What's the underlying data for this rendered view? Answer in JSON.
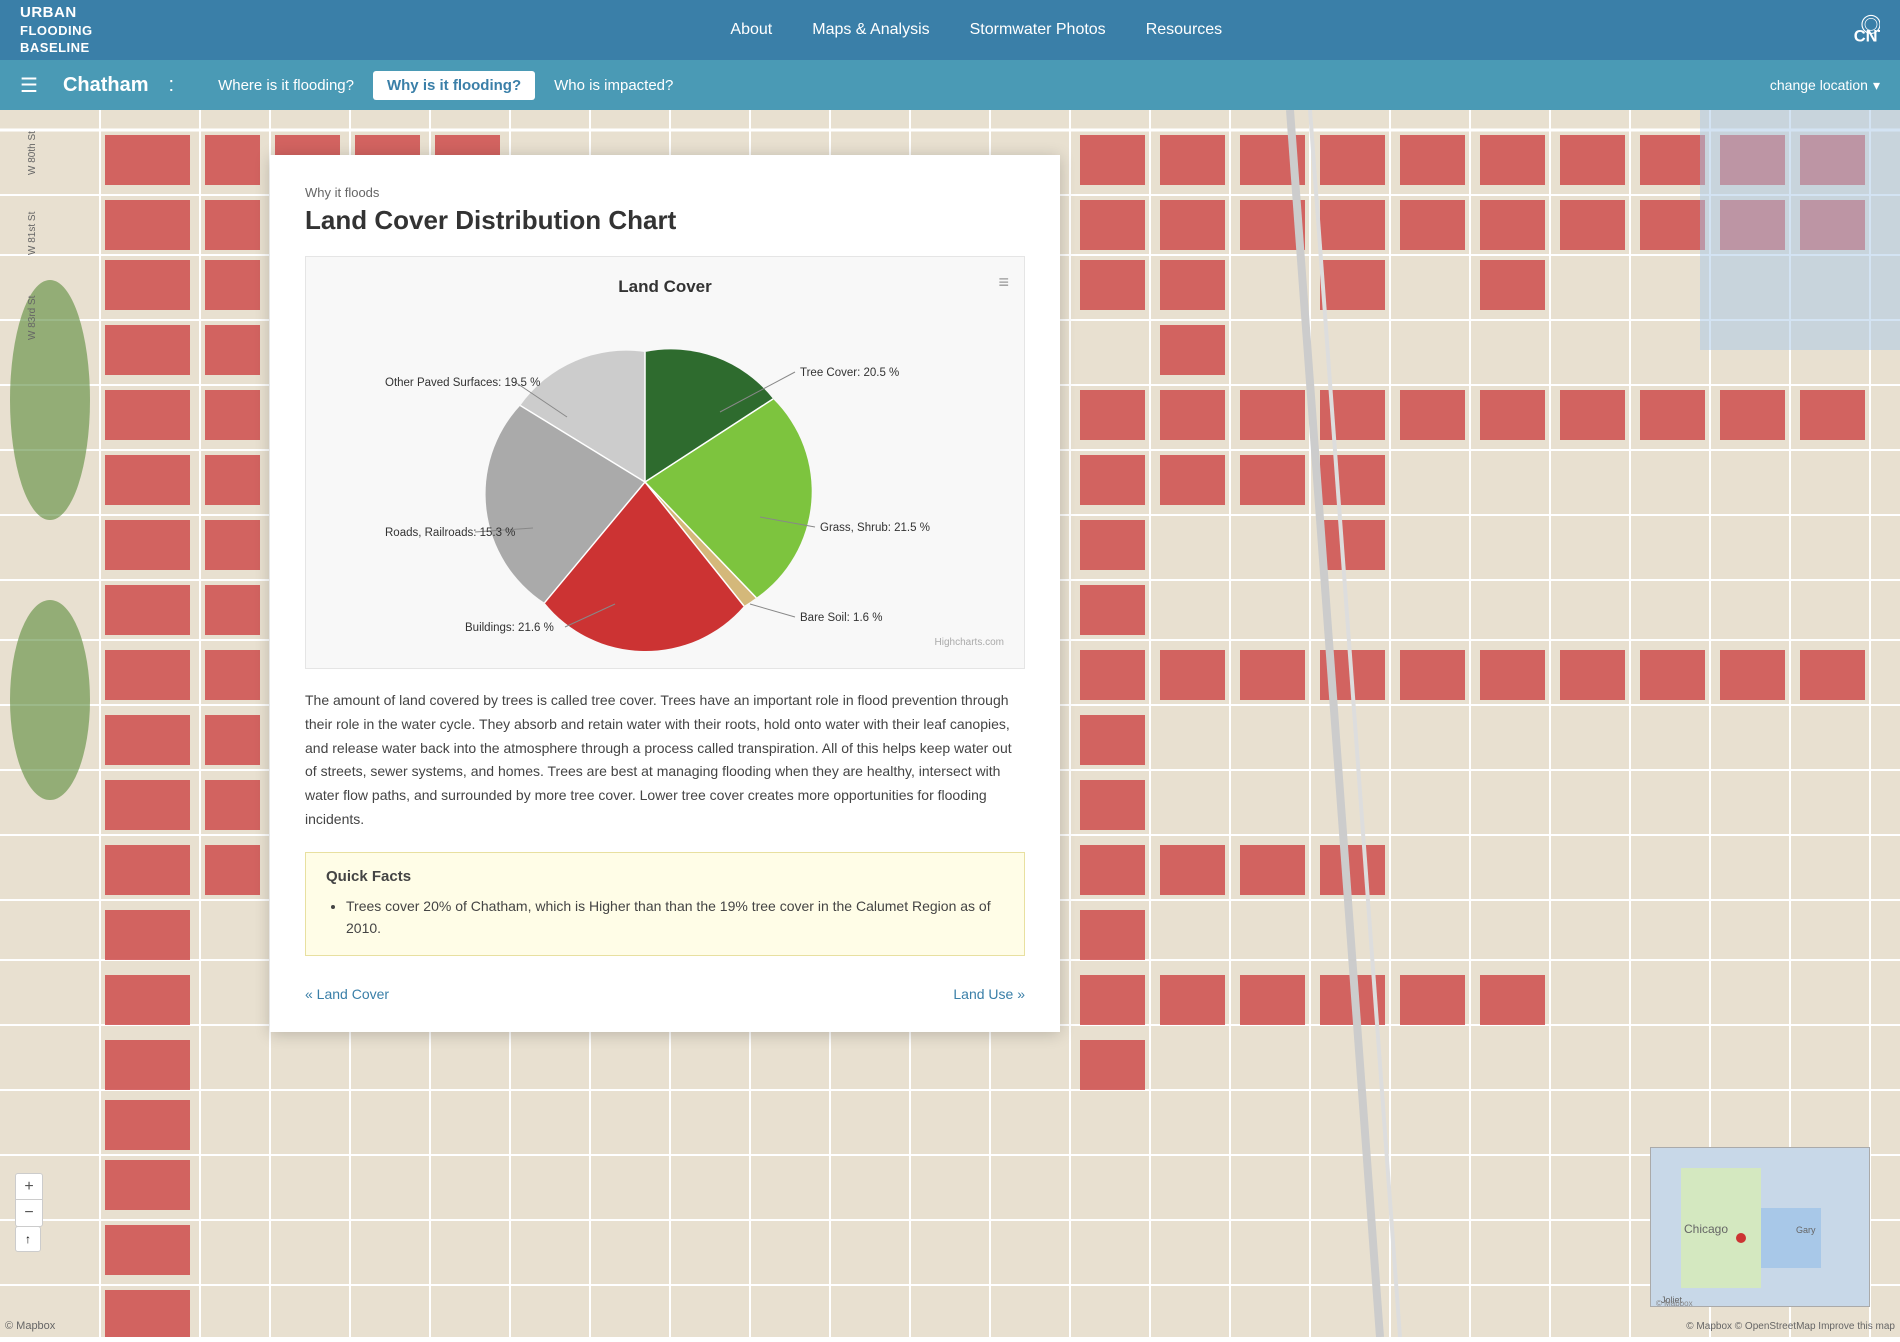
{
  "app": {
    "logo_line1": "URBAN",
    "logo_line2": "FLOODING",
    "logo_line3": "BASELINE"
  },
  "nav": {
    "about": "About",
    "maps_analysis": "Maps & Analysis",
    "stormwater_photos": "Stormwater Photos",
    "resources": "Resources"
  },
  "secondary_nav": {
    "location": "Chatham",
    "colon": ":",
    "where_flooding": "Where is it flooding?",
    "why_flooding": "Why is it flooding?",
    "who_impacted": "Who is impacted?",
    "change_location": "change location"
  },
  "panel": {
    "why_it_floods": "Why it floods",
    "title": "Land Cover Distribution Chart",
    "chart_title": "Land Cover",
    "description": "The amount of land covered by trees is called tree cover. Trees have an important role in flood prevention through their role in the water cycle. They absorb and retain water with their roots, hold onto water with their leaf canopies, and release water back into the atmosphere through a process called transpiration. All of this helps keep water out of streets, sewer systems, and homes. Trees are best at managing flooding when they are healthy, intersect with water flow paths, and surrounded by more tree cover. Lower tree cover creates more opportunities for flooding incidents.",
    "quick_facts_title": "Quick Facts",
    "quick_fact_1": "Trees cover 20% of Chatham, which is Higher than than the 19% tree cover in the Calumet Region as of 2010.",
    "prev_link": "« Land Cover",
    "next_link": "Land Use »",
    "highcharts": "Highcharts.com"
  },
  "chart": {
    "slices": [
      {
        "label": "Tree Cover: 20.5 %",
        "value": 20.5,
        "color": "#2e6b2e",
        "startAngle": -10
      },
      {
        "label": "Grass, Shrub: 21.5 %",
        "value": 21.5,
        "color": "#7dc43e",
        "startAngle": 0
      },
      {
        "label": "Bare Soil: 1.6 %",
        "value": 1.6,
        "color": "#d4b87a",
        "startAngle": 0
      },
      {
        "label": "Buildings: 21.6 %",
        "value": 21.6,
        "color": "#cc3333",
        "startAngle": 0
      },
      {
        "label": "Roads, Railroads: 15.3 %",
        "value": 15.3,
        "color": "#aaaaaa",
        "startAngle": 0
      },
      {
        "label": "Other Paved Surfaces: 19.5 %",
        "value": 19.5,
        "color": "#cccccc",
        "startAngle": 0
      }
    ]
  }
}
